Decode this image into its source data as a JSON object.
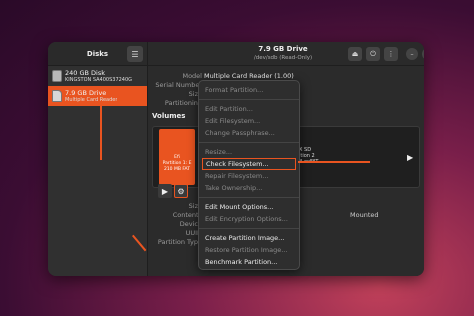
{
  "sidebar": {
    "title": "Disks",
    "menu_icon": "hamburger-icon",
    "disks": [
      {
        "name": "240 GB Disk",
        "sub": "KINGSTON SA400S37240G"
      },
      {
        "name": "7.9 GB Drive",
        "sub": "Multiple Card  Reader"
      }
    ]
  },
  "header": {
    "title": "7.9 GB Drive",
    "subtitle": "/dev/sdb (Read-Only)",
    "eject_icon": "eject-icon",
    "power_icon": "power-icon",
    "menu_icon": "kebab-icon",
    "minimize": "–",
    "maximize": "□",
    "close": "×"
  },
  "info": {
    "model_label": "Model",
    "model_value": "Multiple Card  Reader (1.00)",
    "serial_label": "Serial Number",
    "size_label": "Size",
    "partitioning_label": "Partitioning"
  },
  "volumes": {
    "label": "Volumes",
    "partition_line1": "Efi",
    "partition_line2": "Partition 1: E",
    "partition_line3": "210 MB FAT",
    "right_line1": "X SD",
    "right_line2": "ition 2",
    "right_line3": "B exFAT",
    "play_icon": "▶",
    "gear_icon": "⚙"
  },
  "details": {
    "size_label": "Size",
    "contents_label": "Contents",
    "device_label": "Device",
    "uuid_label": "UUID",
    "partition_type_label": "Partition Type",
    "mounted_text": "Mounted"
  },
  "menu": {
    "items": [
      {
        "label": "Format Partition...",
        "enabled": false
      },
      {
        "sep": true
      },
      {
        "label": "Edit Partition...",
        "enabled": false
      },
      {
        "label": "Edit Filesystem...",
        "enabled": false
      },
      {
        "label": "Change Passphrase...",
        "enabled": false
      },
      {
        "sep": true
      },
      {
        "label": "Resize...",
        "enabled": false
      },
      {
        "label": "Check Filesystem...",
        "enabled": true,
        "highlight": true
      },
      {
        "label": "Repair Filesystem...",
        "enabled": false
      },
      {
        "label": "Take Ownership...",
        "enabled": false
      },
      {
        "sep": true
      },
      {
        "label": "Edit Mount Options...",
        "enabled": true
      },
      {
        "label": "Edit Encryption Options...",
        "enabled": false
      },
      {
        "sep": true
      },
      {
        "label": "Create Partition Image...",
        "enabled": true
      },
      {
        "label": "Restore Partition Image...",
        "enabled": false
      },
      {
        "label": "Benchmark Partition...",
        "enabled": true
      }
    ]
  },
  "colors": {
    "accent": "#e95420",
    "window_bg": "#2b2b2b"
  }
}
